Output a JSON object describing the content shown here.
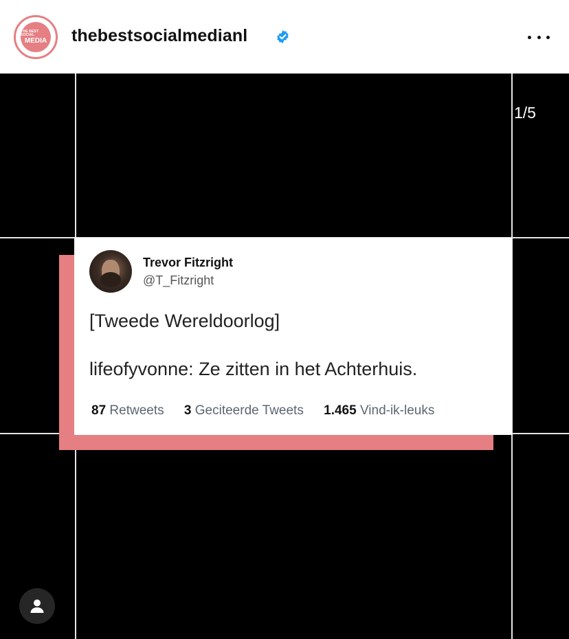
{
  "header": {
    "username": "thebestsocialmedianl",
    "avatar_logo_top": "THE BEST SOCIAL",
    "avatar_logo_bottom": "MEDIA"
  },
  "post": {
    "slide_counter": "1/5"
  },
  "tweet": {
    "author_name": "Trevor Fitzright",
    "author_handle": "@T_Fitzright",
    "line1": "[Tweede Wereldoorlog]",
    "line2": "lifeofyvonne: Ze zitten in het Achterhuis.",
    "retweets_count": "87",
    "retweets_label": "Retweets",
    "quotes_count": "3",
    "quotes_label": "Geciteerde Tweets",
    "likes_count": "1.465",
    "likes_label": "Vind-ik-leuks"
  },
  "colors": {
    "accent_pink": "#e57f83",
    "verified_blue": "#1d9bf0"
  },
  "icons": {
    "verified": "verified-badge-icon",
    "more": "more-options-icon",
    "user": "user-icon"
  }
}
